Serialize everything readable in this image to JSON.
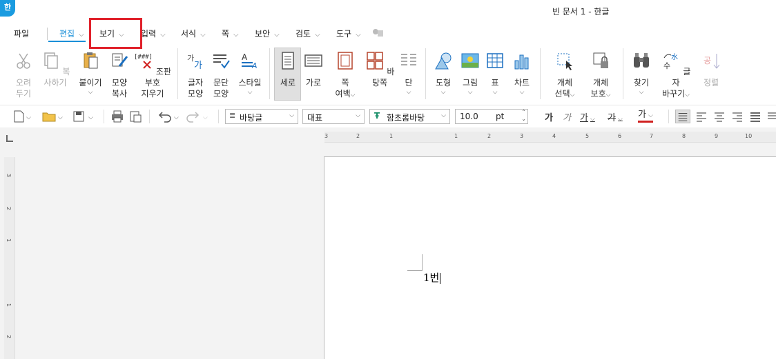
{
  "titlebar": {
    "logo": "한",
    "title": "빈 문서 1 - 한글"
  },
  "menu": {
    "file": "파일",
    "items": [
      "편집",
      "보기",
      "입력",
      "서식",
      "쪽",
      "보안",
      "검토",
      "도구"
    ]
  },
  "ribbon": {
    "cut": [
      "오려",
      "두기"
    ],
    "copy": "복사하기",
    "paste": "붙이기",
    "format_copy": [
      "모양",
      "복사"
    ],
    "clear_marks": [
      "조판 부호",
      "지우기"
    ],
    "char_shape": [
      "글자",
      "모양"
    ],
    "para_shape": [
      "문단",
      "모양"
    ],
    "style": "스타일",
    "portrait": "세로",
    "landscape": "가로",
    "margin": [
      "쪽",
      "여백"
    ],
    "master_page": "바탕쪽",
    "columns": "단",
    "shape": "도형",
    "picture": "그림",
    "table": "표",
    "chart": "차트",
    "select_obj": [
      "개체",
      "선택"
    ],
    "protect_obj": [
      "개체",
      "보호"
    ],
    "find": "찾기",
    "replace": [
      "글자",
      "바꾸기"
    ],
    "sort": "정렬"
  },
  "toolbar": {
    "style_select": "바탕글",
    "lang_select": "대표",
    "font_select": "함초롬바탕",
    "font_size": "10.0",
    "unit": "pt",
    "bold_glyph": "가",
    "italic_glyph": "가",
    "underline_glyph": "가",
    "strike_glyph": "가",
    "color_glyph": "가"
  },
  "ruler": {
    "h_labels": [
      "3",
      "2",
      "1",
      "1",
      "2",
      "3",
      "4",
      "5",
      "6",
      "7",
      "8",
      "9",
      "10"
    ],
    "v_labels": [
      "3",
      "2",
      "1",
      "1",
      "2"
    ]
  },
  "document": {
    "text": "1번"
  },
  "colors": {
    "accent": "#1a8fd8",
    "highlight": "#e0212b",
    "logo": "#1a9be0"
  }
}
